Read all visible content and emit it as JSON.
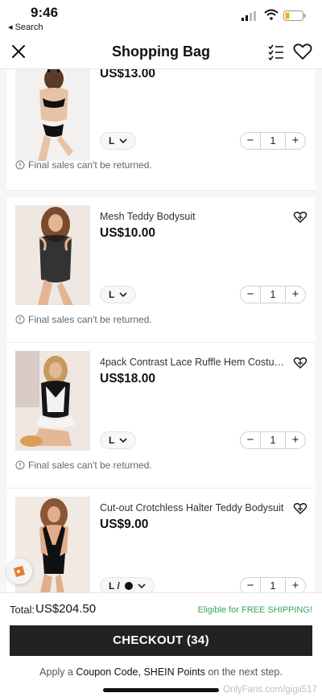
{
  "status_bar": {
    "time": "9:46",
    "back_label": "◂ Search"
  },
  "header": {
    "title": "Shopping Bag"
  },
  "items": [
    {
      "name": "",
      "price": "US$13.00",
      "size": "L",
      "quantity": "1",
      "notice": "Final sales can't be returned."
    },
    {
      "name": "Mesh Teddy Bodysuit",
      "price": "US$10.00",
      "size": "L",
      "quantity": "1",
      "notice": "Final sales can't be returned."
    },
    {
      "name": "4pack Contrast Lace Ruffle Hem Costume",
      "price": "US$18.00",
      "size": "L",
      "quantity": "1",
      "notice": "Final sales can't be returned."
    },
    {
      "name": "Cut-out Crotchless Halter Teddy Bodysuit",
      "price": "US$9.00",
      "size": "L /",
      "quantity": "1"
    }
  ],
  "footer": {
    "total_label": "Total:",
    "total_value": "US$204.50",
    "free_shipping": "Eligible for FREE SHIPPING!",
    "checkout_label": "CHECKOUT (34)",
    "apply_prefix": "Apply a",
    "apply_coupon": "Coupon Code,",
    "apply_points": "SHEIN Points",
    "apply_suffix": "on the next step.",
    "watermark": "OnlyFans.com/gigii517"
  },
  "icons": {
    "close": "close-icon",
    "checklist": "checklist-icon",
    "wishlist": "heart-icon",
    "add_wishlist": "heart-add-icon",
    "info": "info-icon",
    "chevron": "chevron-down-icon"
  },
  "colors": {
    "accent": "#222222",
    "free_shipping": "#3aa55b",
    "badge": "#e8792f"
  }
}
